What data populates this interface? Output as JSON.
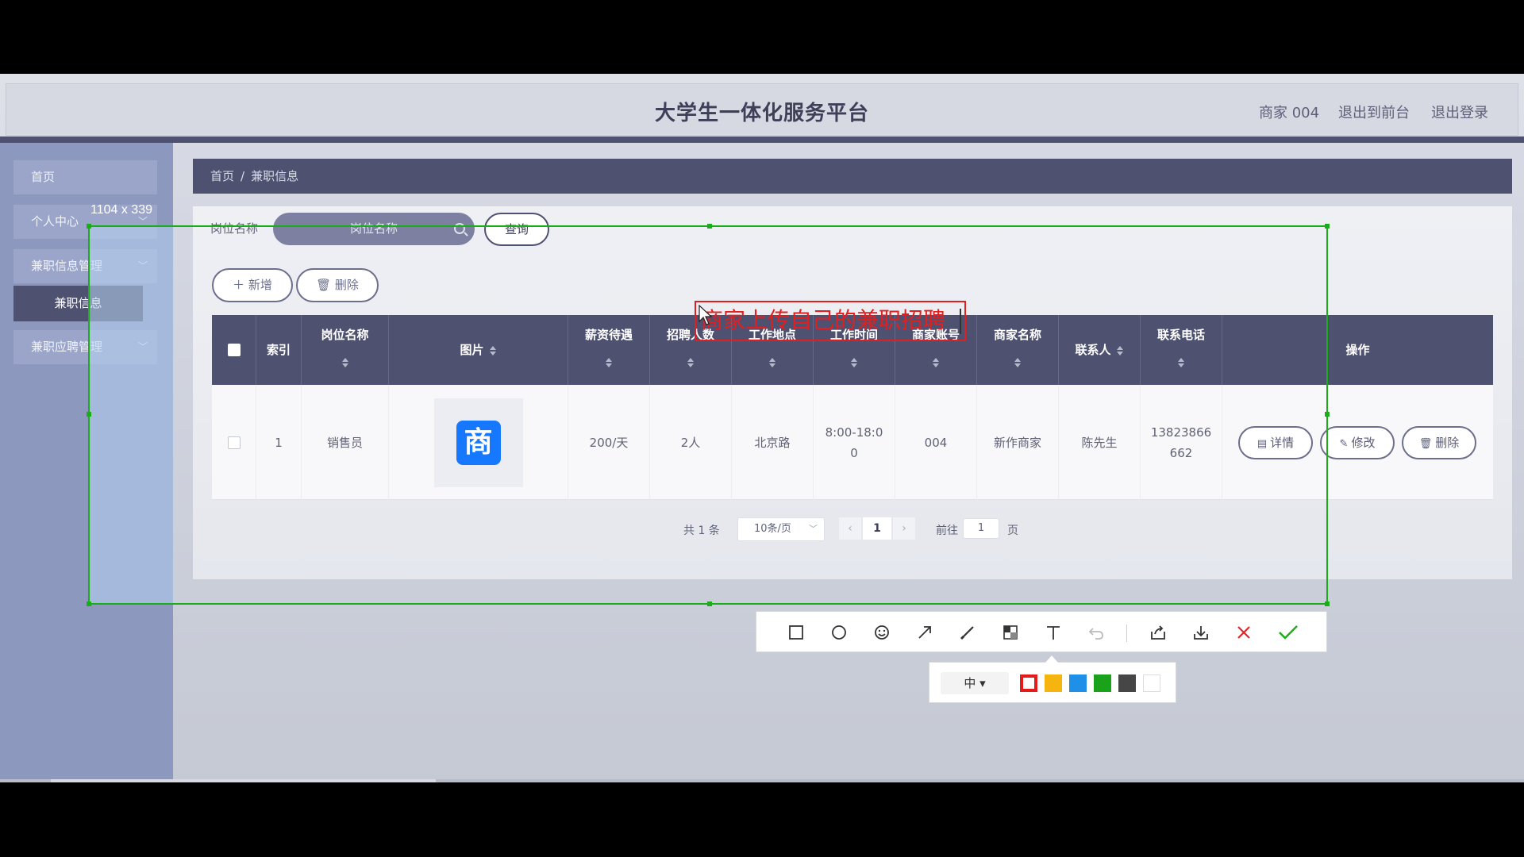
{
  "header": {
    "title": "大学生一体化服务平台",
    "user": "商家 004",
    "to_front": "退出到前台",
    "logout": "退出登录"
  },
  "sidebar": {
    "items": [
      {
        "label": "首页"
      },
      {
        "label": "个人中心"
      },
      {
        "label": "兼职信息管理"
      },
      {
        "label": "兼职信息"
      },
      {
        "label": "兼职应聘管理"
      }
    ]
  },
  "breadcrumb": {
    "home": "首页",
    "sep": "/",
    "current": "兼职信息"
  },
  "search": {
    "label": "岗位名称",
    "placeholder": "岗位名称",
    "query_button": "查询"
  },
  "actions": {
    "add": "新增",
    "delete": "删除"
  },
  "table": {
    "columns": [
      "索引",
      "岗位名称",
      "图片",
      "薪资待遇",
      "招聘人数",
      "工作地点",
      "工作时间",
      "商家账号",
      "商家名称",
      "联系人",
      "联系电话",
      "操作"
    ],
    "rows": [
      {
        "index": "1",
        "job_name": "销售员",
        "image_glyph": "商",
        "salary": "200/天",
        "headcount": "2人",
        "location": "北京路",
        "work_time_1": "8:00-18:0",
        "work_time_2": "0",
        "merchant_account": "004",
        "merchant_name": "新作商家",
        "contact": "陈先生",
        "phone_1": "13823866",
        "phone_2": "662"
      }
    ],
    "row_actions": {
      "detail": "详情",
      "edit": "修改",
      "delete": "删除"
    }
  },
  "pagination": {
    "total": "共 1 条",
    "page_size": "10条/页",
    "current_page": "1",
    "goto_prefix": "前往",
    "goto_value": "1",
    "goto_suffix": "页"
  },
  "capture_overlay": {
    "size_label": "1104 x 339",
    "annotation_text": "商家上传自己的兼职招聘",
    "size_option": "中",
    "colors": [
      "#e31b1b",
      "#f6b40e",
      "#1e90e8",
      "#1aa31a",
      "#464646",
      "#ffffff"
    ],
    "toolbar_icons": [
      "rectangle-icon",
      "ellipse-icon",
      "emoji-icon",
      "arrow-icon",
      "brush-icon",
      "mosaic-icon",
      "text-icon",
      "undo-icon",
      "share-icon",
      "download-icon",
      "cancel-icon",
      "confirm-icon"
    ],
    "frame_color": "#1aad19"
  },
  "colors": {
    "primary": "#4f5170",
    "sidebar": "#8d98bf",
    "logo_blue": "#1677ff"
  }
}
